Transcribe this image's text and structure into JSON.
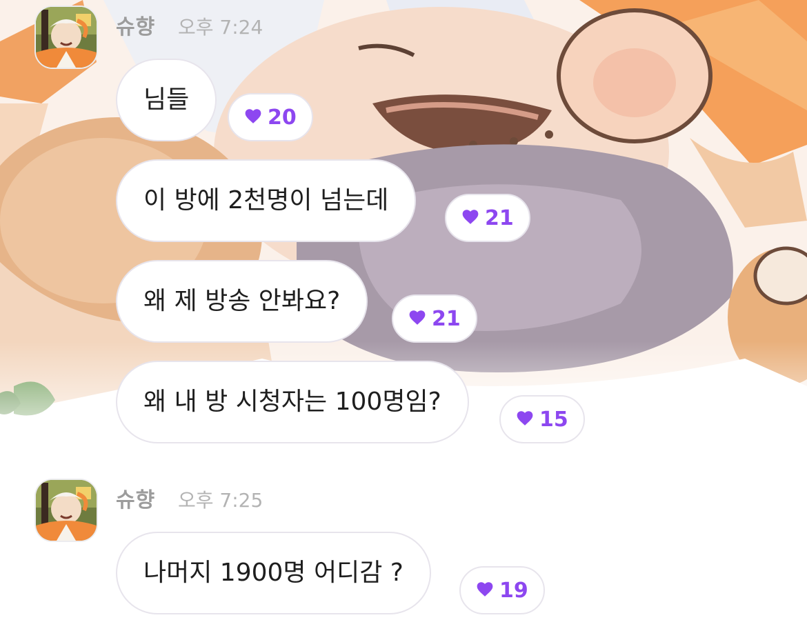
{
  "colors": {
    "accent": "#8d47f0",
    "bubble_border": "#e7e4ec",
    "meta_text": "#9c9c9c"
  },
  "messages": [
    {
      "sender": "슈향",
      "time": "오후 7:24",
      "bubbles": [
        {
          "text": "님들",
          "likes": "20"
        },
        {
          "text": "이 방에 2천명이 넘는데",
          "likes": "21"
        },
        {
          "text": "왜 제 방송 안봐요?",
          "likes": "21"
        },
        {
          "text": "왜 내 방 시청자는 100명임?",
          "likes": "15"
        }
      ]
    },
    {
      "sender": "슈향",
      "time": "오후 7:25",
      "bubbles": [
        {
          "text": "나머지 1900명 어디감 ?",
          "likes": "19"
        }
      ]
    }
  ],
  "icons": {
    "reaction": "heart-icon"
  }
}
